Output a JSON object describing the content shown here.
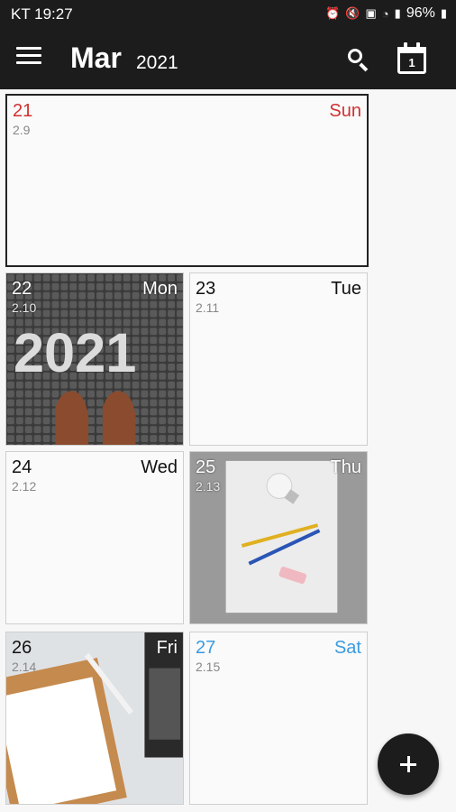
{
  "status_bar": {
    "carrier_time": "KT 19:27",
    "battery": "96%",
    "icons": [
      "alarm-icon",
      "mute-icon",
      "nfc-icon",
      "wifi-icon",
      "signal-icon",
      "battery-icon"
    ]
  },
  "app_bar": {
    "month": "Mar",
    "year": "2021",
    "menu_icon": "hamburger-menu-icon",
    "search_icon": "search-icon",
    "today_icon": "calendar-today-icon",
    "today_icon_number": "1"
  },
  "days": [
    {
      "date": "21",
      "lunar": "2.9",
      "weekday": "Sun",
      "color": "#d03030",
      "selected": true,
      "photo": "none"
    },
    {
      "date": "22",
      "lunar": "2.10",
      "weekday": "Mon",
      "color": "#ffffff",
      "selected": false,
      "photo": "cobblestone-2021-shoes"
    },
    {
      "date": "23",
      "lunar": "2.11",
      "weekday": "Tue",
      "color": "#111111",
      "selected": false,
      "photo": "none"
    },
    {
      "date": "24",
      "lunar": "2.12",
      "weekday": "Wed",
      "color": "#111111",
      "selected": false,
      "photo": "none"
    },
    {
      "date": "25",
      "lunar": "2.13",
      "weekday": "Thu",
      "color": "#ffffff",
      "selected": false,
      "photo": "paper-bulb-pencils"
    },
    {
      "date": "26",
      "lunar": "2.14",
      "weekday": "Fri",
      "color": "#ffffff",
      "selected": false,
      "photo": "clipboard-laptop-marble"
    },
    {
      "date": "27",
      "lunar": "2.15",
      "weekday": "Sat",
      "color": "#3a9be0",
      "selected": false,
      "photo": "none"
    }
  ],
  "photo_text": {
    "mon_photo_text": "2021"
  },
  "fab": {
    "icon": "add-icon"
  },
  "colors": {
    "bar": "#1c1c1c",
    "sunday": "#d03030",
    "saturday": "#3a9be0"
  }
}
